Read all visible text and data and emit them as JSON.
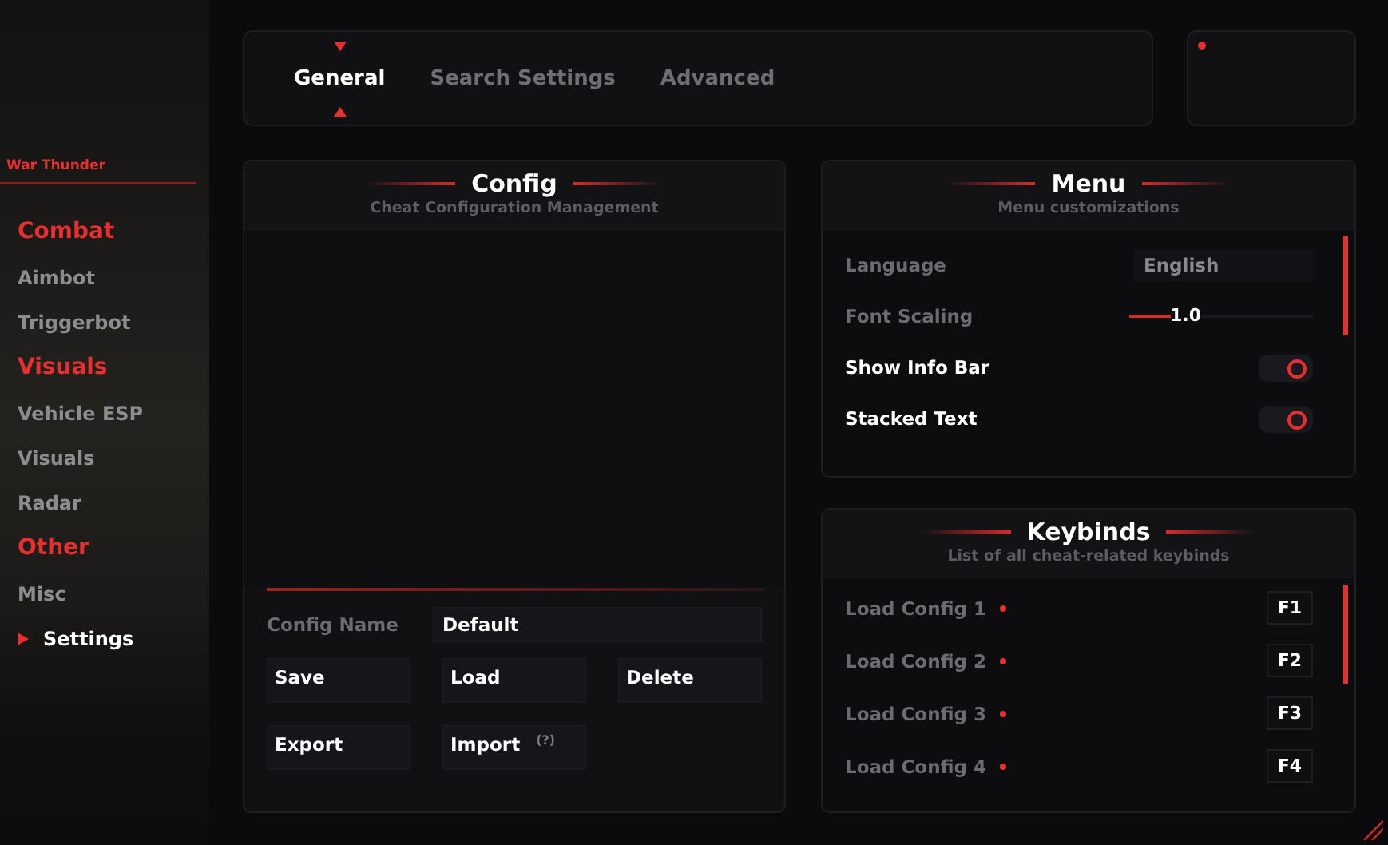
{
  "sidebar": {
    "title": "War Thunder",
    "sections": [
      {
        "label": "Combat",
        "items": [
          {
            "label": "Aimbot",
            "selected": false
          },
          {
            "label": "Triggerbot",
            "selected": false
          }
        ]
      },
      {
        "label": "Visuals",
        "items": [
          {
            "label": "Vehicle ESP",
            "selected": false
          },
          {
            "label": "Visuals",
            "selected": false
          },
          {
            "label": "Radar",
            "selected": false
          }
        ]
      },
      {
        "label": "Other",
        "items": [
          {
            "label": "Misc",
            "selected": false
          },
          {
            "label": "Settings",
            "selected": true
          }
        ]
      }
    ]
  },
  "tabs": [
    {
      "label": "General",
      "selected": true
    },
    {
      "label": "Search Settings",
      "selected": false
    },
    {
      "label": "Advanced",
      "selected": false
    }
  ],
  "config": {
    "title": "Config",
    "subtitle": "Cheat Configuration Management",
    "name_label": "Config Name",
    "name_value": "Default",
    "buttons": [
      {
        "label": "Save"
      },
      {
        "label": "Load"
      },
      {
        "label": "Delete"
      },
      {
        "label": "Export"
      },
      {
        "label": "Import",
        "hint": "(?)"
      }
    ]
  },
  "menu": {
    "title": "Menu",
    "subtitle": "Menu customizations",
    "settings": [
      {
        "kind": "dropdown",
        "label": "Language",
        "value": "English"
      },
      {
        "kind": "slider",
        "label": "Font Scaling",
        "level": 0.3,
        "reading": "1.0"
      },
      {
        "kind": "toggle",
        "label": "Show Info Bar",
        "on": true
      },
      {
        "kind": "toggle",
        "label": "Stacked Text",
        "on": true
      }
    ]
  },
  "keybinds": {
    "title": "Keybinds",
    "subtitle": "List of all cheat-related keybinds",
    "items": [
      {
        "label": "Load Config 1",
        "key": "F1"
      },
      {
        "label": "Load Config 2",
        "key": "F2"
      },
      {
        "label": "Load Config 3",
        "key": "F3"
      },
      {
        "label": "Load Config 4",
        "key": "F4"
      }
    ]
  }
}
